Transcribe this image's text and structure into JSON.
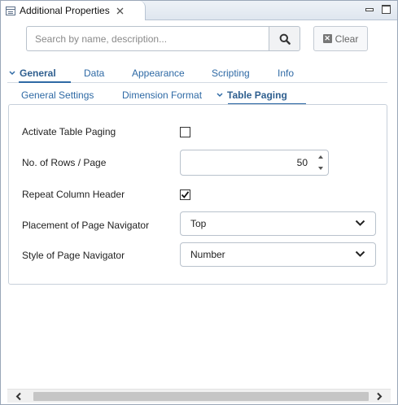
{
  "view": {
    "title": "Additional Properties",
    "close_icon": "close-icon",
    "minimize_icon": "minimize-icon",
    "maximize_icon": "maximize-icon"
  },
  "search": {
    "placeholder": "Search by name, description...",
    "value": "",
    "button_icon": "search-icon",
    "clear_label": "Clear"
  },
  "main_tabs": [
    {
      "label": "General",
      "active": true
    },
    {
      "label": "Data",
      "active": false
    },
    {
      "label": "Appearance",
      "active": false
    },
    {
      "label": "Scripting",
      "active": false
    },
    {
      "label": "Info",
      "active": false
    }
  ],
  "sub_tabs": [
    {
      "label": "General Settings",
      "active": false
    },
    {
      "label": "Dimension Format",
      "active": false
    },
    {
      "label": "Table Paging",
      "active": true
    }
  ],
  "fields": {
    "activate_paging": {
      "label": "Activate Table Paging",
      "checked": false
    },
    "rows_per_page": {
      "label": "No. of Rows / Page",
      "value": "50"
    },
    "repeat_header": {
      "label": "Repeat Column Header",
      "checked": true
    },
    "placement": {
      "label": "Placement of Page Navigator",
      "value": "Top"
    },
    "style": {
      "label": "Style of Page Navigator",
      "value": "Number"
    }
  },
  "colors": {
    "accent": "#2f6aa5",
    "panel_border": "#c7d0da"
  }
}
